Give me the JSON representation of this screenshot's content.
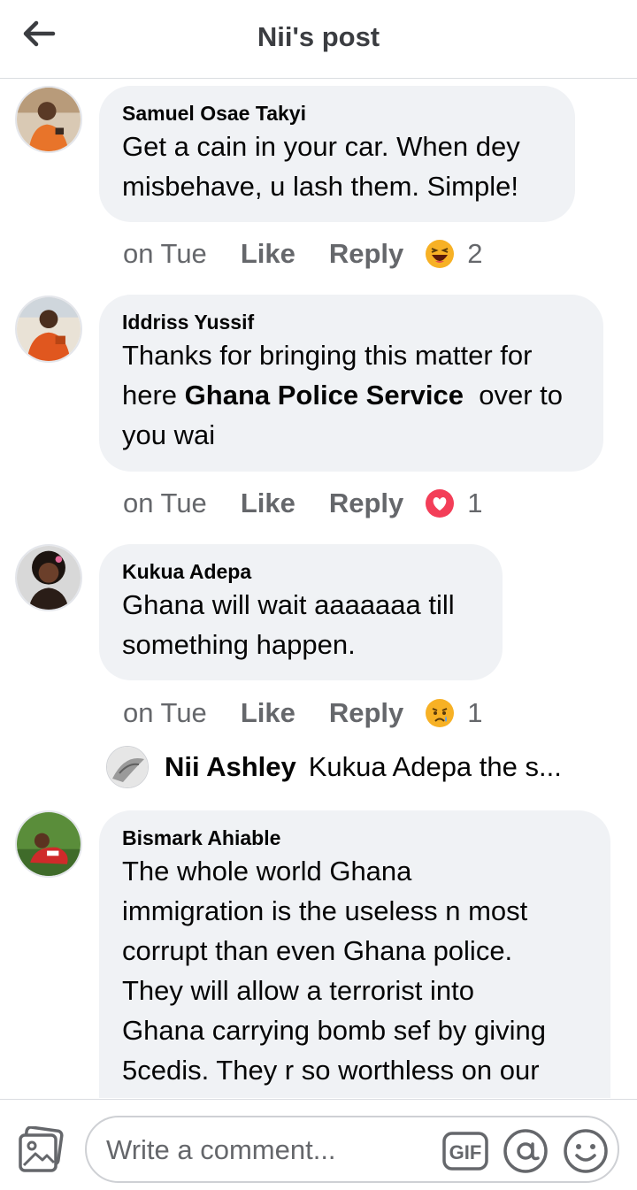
{
  "header": {
    "title": "Nii's post",
    "back_icon": "arrow-left-icon"
  },
  "comments": [
    {
      "author": "Samuel Osae Takyi",
      "lines": [
        "Get a cain in your car. When dey",
        "misbehave, u lash them. Simple!"
      ],
      "time": "on Tue",
      "like": "Like",
      "reply": "Reply",
      "reaction": "laughing-emoji-icon",
      "reaction_count": "2"
    },
    {
      "author": "Iddriss Yussif",
      "line1": "Thanks for bringing this matter for",
      "line2_pre": "here ",
      "line2_bold": "Ghana Police Service",
      "line2_post": "  over to",
      "line3": "you wai",
      "time": "on Tue",
      "like": "Like",
      "reply": "Reply",
      "reaction": "love-heart-icon",
      "reaction_count": "1"
    },
    {
      "author": "Kukua Adepa",
      "lines": [
        "Ghana will wait aaaaaaa till",
        "something happen."
      ],
      "time": "on Tue",
      "like": "Like",
      "reply": "Reply",
      "reaction": "sad-emoji-icon",
      "reaction_count": "1"
    },
    {
      "author": "Bismark Ahiable",
      "lines": [
        "The whole world Ghana",
        "immigration is the useless n most",
        "corrupt than even Ghana police.",
        "They will allow a terrorist into",
        "Ghana carrying bomb sef by giving",
        "5cedis.  They r so worthless on our"
      ]
    }
  ],
  "subreply": {
    "author": "Nii Ashley",
    "text": "Kukua Adepa the s..."
  },
  "composer": {
    "placeholder": "Write a comment...",
    "gif_label": "GIF"
  },
  "colors": {
    "bubble": "#f0f2f5",
    "meta": "#65676b",
    "love": "#f33e58",
    "emoji": "#f7b125"
  }
}
